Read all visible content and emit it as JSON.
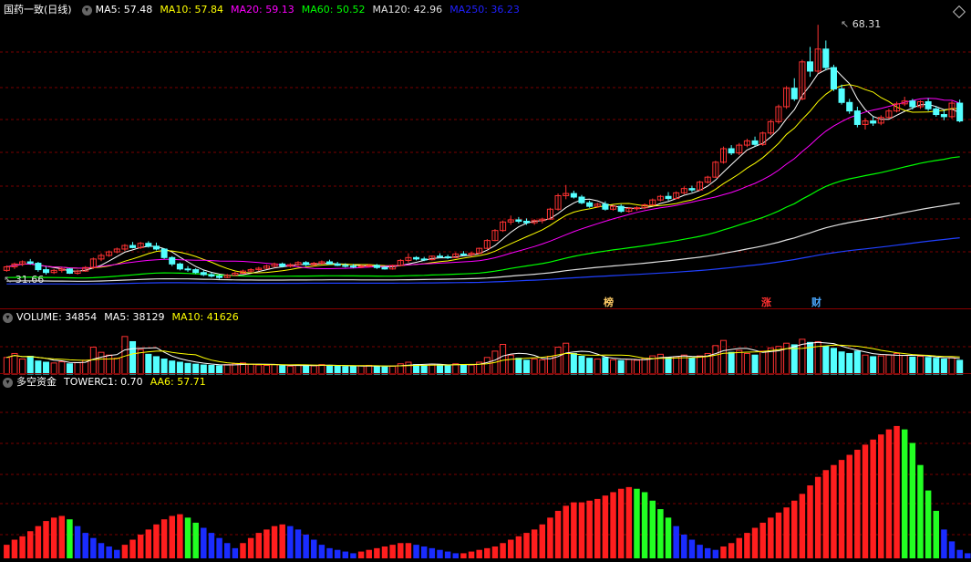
{
  "panels": {
    "price": {
      "title": "国药一致(日线)",
      "indicators": [
        {
          "label": "MA5: 57.48",
          "color": "#ffffff"
        },
        {
          "label": "MA10: 57.84",
          "color": "#ffff00"
        },
        {
          "label": "MA20: 59.13",
          "color": "#ff00ff"
        },
        {
          "label": "MA60: 50.52",
          "color": "#00ff00"
        },
        {
          "label": "MA120: 42.96",
          "color": "#e0e0e0"
        },
        {
          "label": "MA250: 36.23",
          "color": "#2020ff"
        }
      ],
      "high_label": "68.31",
      "low_label": "31.66",
      "events": [
        "榜",
        "涨",
        "财"
      ]
    },
    "volume": {
      "indicators": [
        {
          "label": "VOLUME: 34854",
          "color": "#ffffff"
        },
        {
          "label": "MA5: 38129",
          "color": "#ffffff"
        },
        {
          "label": "MA10: 41626",
          "color": "#ffff00"
        }
      ]
    },
    "tower": {
      "title": "多空资金",
      "indicators": [
        {
          "label": "TOWERC1: 0.70",
          "color": "#ffffff"
        },
        {
          "label": "AA6: 57.71",
          "color": "#ffff00"
        }
      ]
    }
  },
  "chart_data": [
    {
      "type": "candlestick",
      "title": "国药一致(日线)",
      "ylim": [
        30,
        70
      ],
      "bars": [
        [
          33.8,
          34.5,
          33.6,
          34.3
        ],
        [
          34.3,
          34.9,
          34.0,
          34.7
        ],
        [
          34.7,
          35.2,
          34.4,
          35.0
        ],
        [
          35.0,
          35.4,
          34.6,
          34.8
        ],
        [
          34.8,
          35.0,
          33.6,
          33.9
        ],
        [
          33.9,
          34.3,
          33.2,
          33.5
        ],
        [
          33.5,
          34.0,
          33.3,
          33.8
        ],
        [
          33.8,
          34.2,
          33.5,
          34.0
        ],
        [
          34.0,
          34.1,
          33.3,
          33.4
        ],
        [
          33.4,
          33.9,
          33.2,
          33.7
        ],
        [
          33.7,
          34.4,
          33.6,
          34.2
        ],
        [
          34.2,
          35.6,
          34.0,
          35.4
        ],
        [
          35.4,
          36.2,
          35.1,
          35.9
        ],
        [
          35.9,
          36.6,
          35.7,
          36.4
        ],
        [
          36.4,
          37.0,
          36.2,
          36.8
        ],
        [
          36.8,
          37.5,
          36.5,
          37.3
        ],
        [
          37.3,
          37.8,
          36.9,
          37.0
        ],
        [
          37.0,
          37.8,
          36.8,
          37.6
        ],
        [
          37.6,
          37.9,
          37.0,
          37.2
        ],
        [
          37.2,
          37.7,
          36.6,
          36.8
        ],
        [
          36.8,
          36.9,
          35.4,
          35.6
        ],
        [
          35.6,
          35.8,
          34.4,
          34.7
        ],
        [
          34.7,
          34.9,
          33.8,
          34.0
        ],
        [
          34.0,
          34.4,
          33.6,
          33.9
        ],
        [
          33.9,
          34.1,
          33.3,
          33.5
        ],
        [
          33.5,
          33.8,
          33.0,
          33.2
        ],
        [
          33.2,
          33.5,
          32.8,
          33.0
        ],
        [
          33.0,
          33.2,
          32.6,
          32.8
        ],
        [
          32.8,
          33.3,
          32.7,
          33.1
        ],
        [
          33.1,
          33.6,
          33.0,
          33.4
        ],
        [
          33.4,
          33.9,
          33.3,
          33.7
        ],
        [
          33.7,
          34.1,
          33.5,
          33.9
        ],
        [
          33.9,
          34.3,
          33.7,
          34.1
        ],
        [
          34.1,
          34.6,
          34.0,
          34.4
        ],
        [
          34.4,
          34.9,
          34.2,
          34.7
        ],
        [
          34.7,
          34.9,
          34.2,
          34.4
        ],
        [
          34.4,
          34.8,
          34.2,
          34.6
        ],
        [
          34.6,
          35.1,
          34.4,
          34.9
        ],
        [
          34.9,
          35.1,
          34.4,
          34.6
        ],
        [
          34.6,
          35.0,
          34.4,
          34.8
        ],
        [
          34.8,
          35.2,
          34.6,
          35.0
        ],
        [
          35.0,
          35.3,
          34.6,
          34.7
        ],
        [
          34.7,
          35.0,
          34.4,
          34.5
        ],
        [
          34.5,
          34.8,
          34.2,
          34.4
        ],
        [
          34.4,
          34.7,
          34.1,
          34.3
        ],
        [
          34.3,
          34.6,
          34.1,
          34.4
        ],
        [
          34.4,
          34.7,
          34.2,
          34.5
        ],
        [
          34.5,
          34.7,
          34.0,
          34.2
        ],
        [
          34.2,
          34.4,
          33.9,
          34.0
        ],
        [
          34.0,
          34.6,
          33.9,
          34.5
        ],
        [
          34.5,
          35.4,
          34.4,
          35.2
        ],
        [
          35.2,
          36.2,
          34.9,
          35.6
        ],
        [
          35.6,
          35.8,
          35.2,
          35.4
        ],
        [
          35.4,
          35.7,
          35.1,
          35.3
        ],
        [
          35.3,
          35.9,
          35.2,
          35.8
        ],
        [
          35.8,
          36.2,
          35.5,
          35.7
        ],
        [
          35.7,
          36.0,
          35.4,
          35.6
        ],
        [
          35.6,
          36.3,
          35.5,
          36.1
        ],
        [
          36.1,
          36.5,
          35.8,
          36.0
        ],
        [
          36.0,
          36.4,
          35.7,
          36.2
        ],
        [
          36.2,
          37.0,
          36.1,
          36.9
        ],
        [
          36.9,
          38.2,
          36.8,
          38.0
        ],
        [
          38.0,
          39.6,
          37.9,
          39.4
        ],
        [
          39.4,
          40.8,
          39.2,
          40.6
        ],
        [
          40.6,
          41.5,
          40.2,
          40.9
        ],
        [
          40.9,
          41.3,
          40.4,
          40.7
        ],
        [
          40.7,
          41.1,
          40.2,
          40.5
        ],
        [
          40.5,
          41.0,
          40.2,
          40.8
        ],
        [
          40.8,
          41.2,
          40.4,
          41.0
        ],
        [
          41.0,
          42.6,
          40.9,
          42.4
        ],
        [
          42.4,
          44.6,
          42.2,
          44.3
        ],
        [
          44.3,
          45.8,
          43.8,
          44.6
        ],
        [
          44.6,
          45.0,
          43.9,
          44.1
        ],
        [
          44.1,
          44.4,
          43.1,
          43.3
        ],
        [
          43.3,
          43.6,
          42.6,
          42.8
        ],
        [
          42.8,
          43.3,
          42.6,
          43.1
        ],
        [
          43.1,
          43.5,
          42.2,
          42.4
        ],
        [
          42.4,
          43.0,
          42.2,
          42.8
        ],
        [
          42.8,
          43.1,
          41.9,
          42.1
        ],
        [
          42.1,
          42.7,
          41.9,
          42.5
        ],
        [
          42.5,
          42.8,
          42.2,
          42.6
        ],
        [
          42.6,
          43.2,
          42.4,
          43.0
        ],
        [
          43.0,
          43.9,
          42.9,
          43.7
        ],
        [
          43.7,
          44.4,
          43.5,
          44.2
        ],
        [
          44.2,
          44.8,
          43.6,
          43.9
        ],
        [
          43.9,
          44.9,
          43.8,
          44.7
        ],
        [
          44.7,
          45.6,
          44.5,
          45.3
        ],
        [
          45.3,
          45.7,
          44.8,
          45.1
        ],
        [
          45.1,
          46.4,
          45.0,
          46.2
        ],
        [
          46.2,
          47.1,
          46.0,
          46.9
        ],
        [
          46.9,
          49.2,
          46.8,
          49.0
        ],
        [
          49.0,
          51.2,
          48.8,
          50.9
        ],
        [
          50.9,
          51.4,
          50.0,
          50.3
        ],
        [
          50.3,
          51.7,
          50.0,
          51.4
        ],
        [
          51.4,
          52.3,
          51.1,
          52.0
        ],
        [
          52.0,
          52.6,
          51.2,
          51.5
        ],
        [
          51.5,
          53.3,
          51.3,
          53.1
        ],
        [
          53.1,
          55.0,
          52.8,
          54.7
        ],
        [
          54.7,
          57.1,
          54.4,
          56.8
        ],
        [
          56.8,
          59.7,
          56.5,
          59.4
        ],
        [
          59.4,
          60.8,
          57.6,
          57.9
        ],
        [
          57.9,
          63.4,
          57.7,
          63.1
        ],
        [
          63.1,
          65.2,
          61.0,
          61.8
        ],
        [
          61.8,
          68.31,
          61.5,
          64.9
        ],
        [
          64.9,
          66.1,
          61.9,
          62.3
        ],
        [
          62.3,
          62.7,
          59.0,
          59.3
        ],
        [
          59.3,
          59.9,
          57.1,
          57.4
        ],
        [
          57.4,
          57.9,
          55.8,
          56.2
        ],
        [
          56.2,
          56.8,
          53.9,
          54.3
        ],
        [
          54.3,
          55.2,
          53.6,
          54.8
        ],
        [
          54.8,
          55.4,
          54.1,
          54.5
        ],
        [
          54.5,
          55.6,
          54.2,
          55.3
        ],
        [
          55.3,
          56.5,
          55.1,
          56.2
        ],
        [
          56.2,
          57.5,
          56.0,
          57.2
        ],
        [
          57.2,
          58.2,
          56.9,
          57.6
        ],
        [
          57.6,
          57.9,
          56.4,
          56.8
        ],
        [
          56.8,
          57.7,
          56.5,
          57.5
        ],
        [
          57.5,
          58.0,
          56.2,
          56.5
        ],
        [
          56.5,
          56.9,
          55.4,
          55.7
        ],
        [
          55.7,
          56.3,
          54.9,
          55.4
        ],
        [
          55.4,
          57.6,
          55.1,
          57.3
        ],
        [
          57.3,
          57.8,
          54.6,
          54.8
        ]
      ]
    },
    {
      "type": "bar",
      "title": "VOLUME",
      "ylim": [
        0,
        120000
      ],
      "values": [
        42000,
        52000,
        38000,
        45000,
        33000,
        30000,
        28000,
        31000,
        26000,
        29000,
        35000,
        68000,
        55000,
        48000,
        40000,
        95000,
        82000,
        62000,
        50000,
        44000,
        38000,
        33000,
        30000,
        27000,
        25000,
        23000,
        22000,
        21000,
        24000,
        26000,
        28000,
        25000,
        23000,
        22000,
        24000,
        21000,
        20000,
        22000,
        23000,
        21000,
        24000,
        22000,
        20000,
        19000,
        20000,
        21000,
        22000,
        19000,
        18000,
        20000,
        26000,
        30000,
        24000,
        22000,
        25000,
        23000,
        22000,
        26000,
        24000,
        23000,
        30000,
        42000,
        58000,
        75000,
        48000,
        40000,
        35000,
        38000,
        36000,
        45000,
        68000,
        78000,
        52000,
        45000,
        40000,
        38000,
        42000,
        36000,
        34000,
        37000,
        35000,
        40000,
        46000,
        50000,
        42000,
        44000,
        48000,
        40000,
        46000,
        52000,
        72000,
        85000,
        55000,
        60000,
        52000,
        48000,
        58000,
        66000,
        70000,
        78000,
        74000,
        88000,
        80000,
        82000,
        70000,
        65000,
        56000,
        52000,
        58000,
        48000,
        44000,
        46000,
        48000,
        52000,
        47000,
        43000,
        45000,
        42000,
        40000,
        38000,
        41000,
        34854
      ]
    },
    {
      "type": "bar",
      "title": "多空资金",
      "ylim": [
        0,
        100
      ],
      "values": [
        8,
        11,
        13,
        16,
        19,
        22,
        24,
        25,
        23,
        19,
        15,
        12,
        9,
        7,
        5,
        8,
        11,
        14,
        17,
        20,
        23,
        25,
        26,
        24,
        21,
        18,
        15,
        12,
        9,
        6,
        9,
        12,
        15,
        17,
        19,
        20,
        19,
        17,
        14,
        11,
        8,
        6,
        5,
        4,
        3,
        4,
        5,
        6,
        7,
        8,
        9,
        9,
        8,
        7,
        6,
        5,
        4,
        3,
        3,
        4,
        5,
        6,
        7,
        9,
        11,
        13,
        15,
        17,
        20,
        24,
        28,
        31,
        33,
        33,
        34,
        35,
        37,
        39,
        41,
        42,
        41,
        39,
        34,
        29,
        24,
        19,
        14,
        11,
        8,
        6,
        5,
        7,
        9,
        12,
        15,
        18,
        21,
        24,
        27,
        30,
        34,
        38,
        43,
        48,
        52,
        55,
        58,
        61,
        64,
        67,
        70,
        73,
        76,
        78,
        76,
        68,
        55,
        40,
        28,
        17,
        10,
        5,
        3,
        1,
        2,
        4,
        6,
        7,
        6,
        4
      ]
    }
  ]
}
